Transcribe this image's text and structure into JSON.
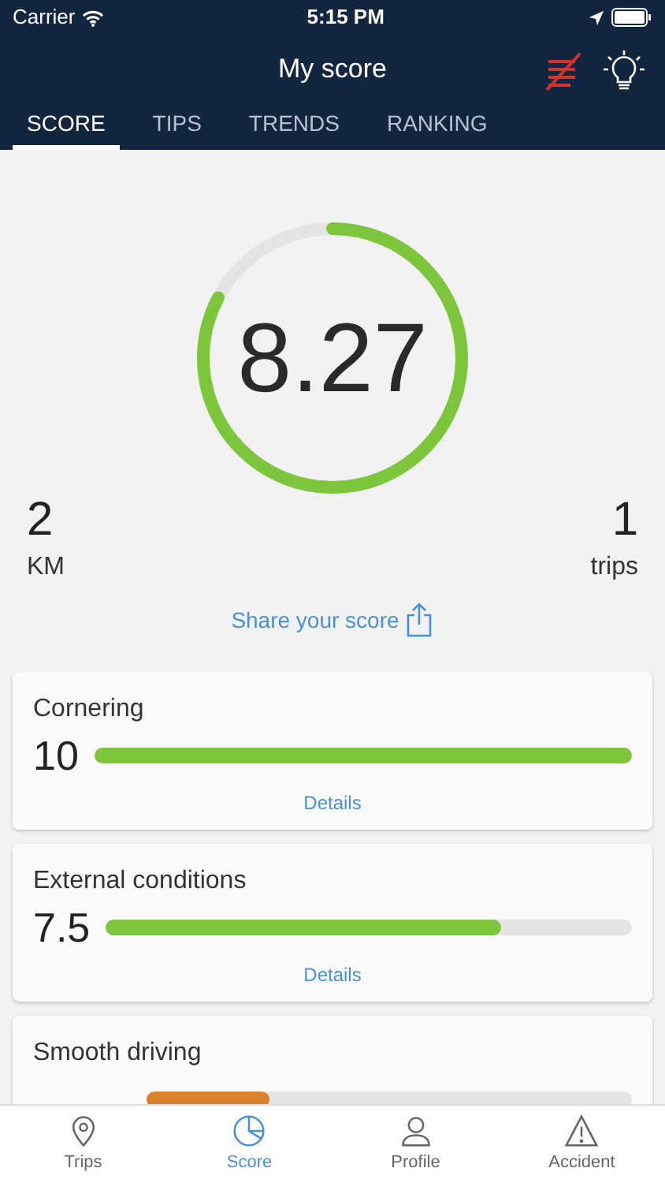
{
  "status_bar": {
    "carrier": "Carrier",
    "time": "5:15 PM"
  },
  "header": {
    "title": "My score"
  },
  "tabs": [
    {
      "label": "SCORE",
      "selected": true
    },
    {
      "label": "TIPS",
      "selected": false
    },
    {
      "label": "TRENDS",
      "selected": false
    },
    {
      "label": "RANKING",
      "selected": false
    }
  ],
  "score": {
    "value": "8.27",
    "level": 0.827
  },
  "stats": [
    {
      "value": "2",
      "unit": "KM"
    },
    {
      "value": "1",
      "unit": "trips"
    }
  ],
  "share": {
    "label": "Share your score"
  },
  "categories": [
    {
      "name": "Cornering",
      "value": "10",
      "level": 1,
      "color": "#7dc63c",
      "details": "Details"
    },
    {
      "name": "External conditions",
      "value": "7.5",
      "level": 0.75,
      "color": "#7dc63c",
      "details": "Details"
    },
    {
      "name": "Smooth driving",
      "level": 0.252,
      "color": "#d9822b"
    }
  ],
  "bottom_nav": [
    {
      "label": "Trips",
      "kind": "pin",
      "selected": false
    },
    {
      "label": "Score",
      "kind": "pie",
      "selected": true
    },
    {
      "label": "Profile",
      "kind": "person",
      "selected": false
    },
    {
      "label": "Accident",
      "kind": "warning",
      "selected": false
    }
  ]
}
